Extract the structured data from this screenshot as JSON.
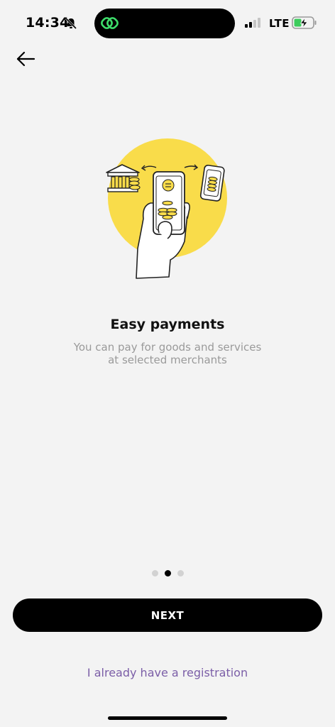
{
  "status_bar": {
    "time": "14:34",
    "network": "LTE",
    "icons": [
      "bell-slash-icon",
      "link-icon",
      "signal-icon",
      "battery-charging-icon"
    ]
  },
  "nav": {
    "back_icon": "arrow-left-icon"
  },
  "onboarding": {
    "title": "Easy payments",
    "subtitle": "You can pay for goods and services at selected merchants",
    "page_count": 3,
    "active_page": 2
  },
  "actions": {
    "next_label": "NEXT",
    "login_link": "I already have a registration"
  },
  "colors": {
    "background": "#f3f3f3",
    "accent_yellow": "#f9dc4a",
    "link": "#7b5ea7",
    "button": "#000000"
  }
}
